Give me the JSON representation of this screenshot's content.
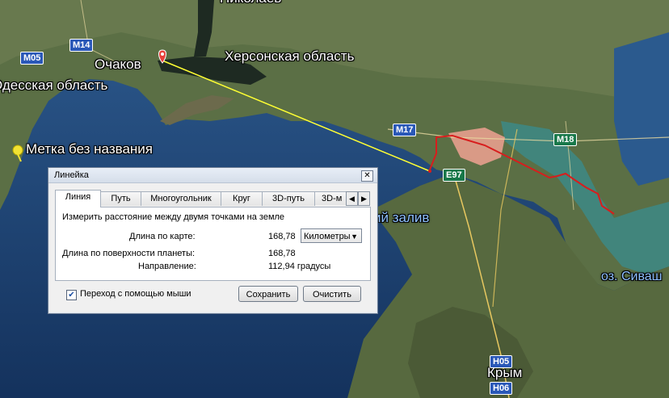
{
  "map": {
    "labels": {
      "nikolaev": "Николаев",
      "ochakov": "Очаков",
      "kherson_oblast": "Херсонская область",
      "odessa_oblast": "Одесская область",
      "placemark": "Метка без названия",
      "gulf": "ий залив",
      "sivash": "оз. Сиваш",
      "crimea": "Крым"
    },
    "roads": {
      "m14": "M14",
      "m05": "M05",
      "m17": "M17",
      "m18": "M18",
      "e97": "E97",
      "h05": "H05",
      "h06": "H06"
    },
    "colors": {
      "measure_line": "#ffff33",
      "path_line": "#d81d1d",
      "pin": "#e8403a",
      "water": "#1f3f6e"
    }
  },
  "ruler": {
    "title": "Линейка",
    "tabs": [
      "Линия",
      "Путь",
      "Многоугольник",
      "Круг",
      "3D-путь",
      "3D-м"
    ],
    "description": "Измерить расстояние между двумя точками на земле",
    "map_length_label": "Длина по карте:",
    "map_length_value": "168,78",
    "unit": "Километры",
    "ground_length_label": "Длина по поверхности планеты:",
    "ground_length_value": "168,78",
    "heading_label": "Направление:",
    "heading_value": "112,94 градусы",
    "mouse_nav_label": "Переход с помощью мыши",
    "mouse_nav_checked": true,
    "save_label": "Сохранить",
    "clear_label": "Очистить"
  }
}
